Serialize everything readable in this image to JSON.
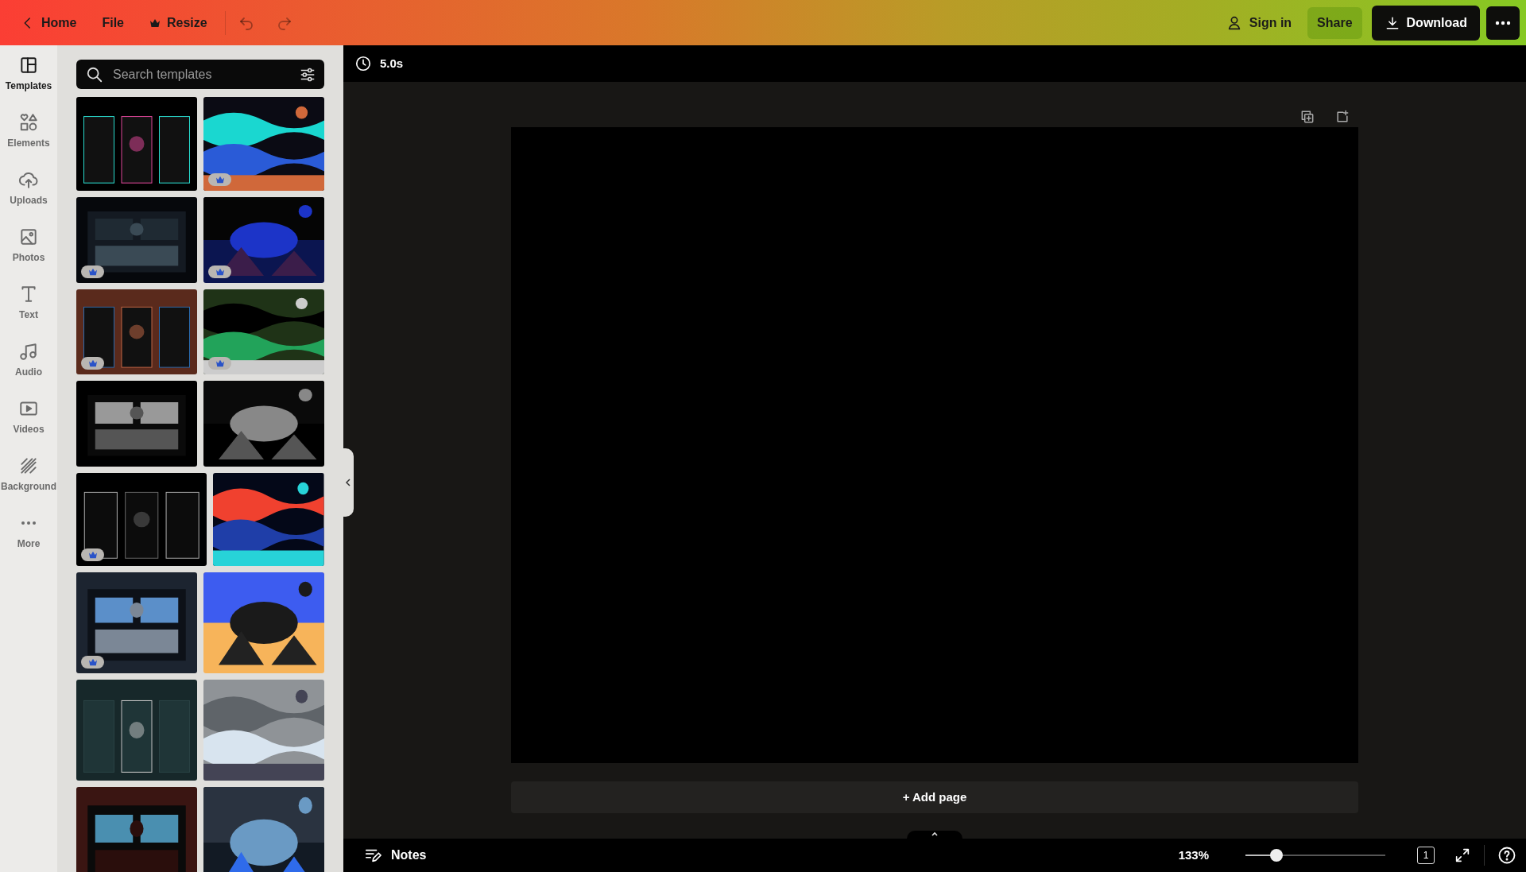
{
  "topbar": {
    "home": "Home",
    "file": "File",
    "resize": "Resize",
    "sign_in": "Sign in",
    "share": "Share",
    "download": "Download"
  },
  "rail": [
    {
      "kind": "templates",
      "label": "Templates",
      "selected": true
    },
    {
      "kind": "elements",
      "label": "Elements",
      "selected": false
    },
    {
      "kind": "uploads",
      "label": "Uploads",
      "selected": false
    },
    {
      "kind": "photos",
      "label": "Photos",
      "selected": false
    },
    {
      "kind": "text",
      "label": "Text",
      "selected": false
    },
    {
      "kind": "audio",
      "label": "Audio",
      "selected": false
    },
    {
      "kind": "videos",
      "label": "Videos",
      "selected": false
    },
    {
      "kind": "background",
      "label": "Background",
      "selected": false
    },
    {
      "kind": "more",
      "label": "More",
      "selected": false
    }
  ],
  "search": {
    "placeholder": "Search templates"
  },
  "templates": [
    {
      "kind": "picture",
      "premium": false
    },
    {
      "kind": "picture",
      "premium": true
    },
    {
      "kind": "picture",
      "premium": true
    },
    {
      "kind": "picture",
      "premium": true
    },
    {
      "kind": "picture",
      "premium": true
    },
    {
      "kind": "picture",
      "premium": true
    },
    {
      "kind": "picture",
      "premium": false
    },
    {
      "kind": "picture",
      "premium": false
    },
    {
      "kind": "picture",
      "premium": true
    },
    {
      "kind": "picture",
      "premium": false
    },
    {
      "kind": "picture",
      "premium": true
    },
    {
      "kind": "picture",
      "premium": false
    },
    {
      "kind": "picture",
      "premium": false
    },
    {
      "kind": "picture",
      "premium": false
    },
    {
      "kind": "picture"
    },
    {
      "kind": "picture"
    }
  ],
  "duration": "5.0s",
  "add_page": "+ Add page",
  "footer": {
    "notes": "Notes",
    "zoom": "133%",
    "zoom_slider": {
      "level": 0.22
    },
    "page_count": "1"
  }
}
